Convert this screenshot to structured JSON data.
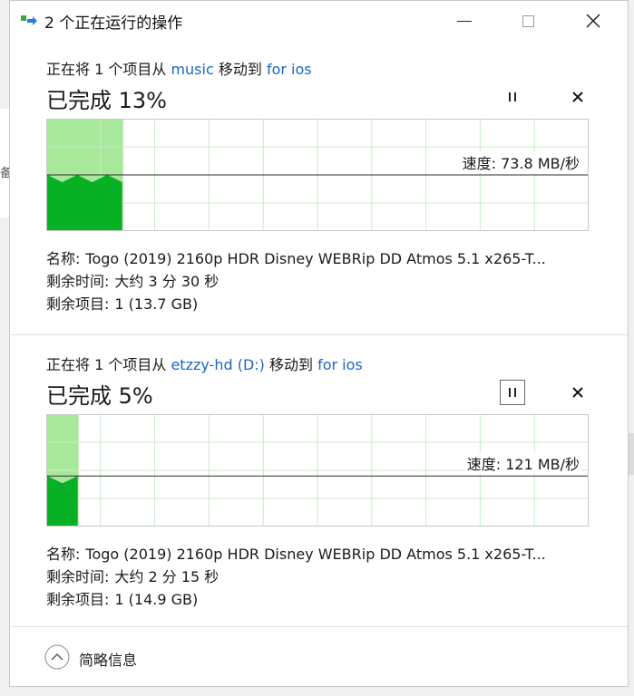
{
  "window": {
    "title": "2 个正在运行的操作"
  },
  "colors": {
    "fill_dark": "#08b026",
    "fill_light": "#a8e89a",
    "grid": "#c8ebc8",
    "link": "#1a66c2"
  },
  "operations": [
    {
      "desc_prefix": "正在将 1 个项目从 ",
      "source": "music",
      "desc_middle": " 移动到 ",
      "destination": "for ios",
      "percent_text": "已完成 13%",
      "progress": 0.14,
      "speed_text": "速度: 73.8 MB/秒",
      "speed_level": 0.5,
      "name_label": "名称:",
      "name_value": "Togo (2019) 2160p HDR Disney WEBRip DD Atmos 5.1 x265-T...",
      "time_label": "剩余时间:",
      "time_value": "大约 3 分 30 秒",
      "items_label": "剩余项目:",
      "items_value": "1 (13.7 GB)"
    },
    {
      "desc_prefix": "正在将 1 个项目从 ",
      "source": "etzzy-hd (D:)",
      "desc_middle": " 移动到 ",
      "destination": "for ios",
      "percent_text": "已完成 5%",
      "progress": 0.058,
      "speed_text": "速度: 121 MB/秒",
      "speed_level": 0.45,
      "name_label": "名称:",
      "name_value": "Togo (2019) 2160p HDR Disney WEBRip DD Atmos 5.1 x265-T...",
      "time_label": "剩余时间:",
      "time_value": "大约 2 分 15 秒",
      "items_label": "剩余项目:",
      "items_value": "1 (14.9 GB)"
    }
  ],
  "footer": {
    "toggle_label": "简略信息"
  },
  "icons": {
    "app": "file-move-icon",
    "pause": "pause-icon",
    "cancel": "close-icon",
    "collapse": "chevron-up-icon"
  }
}
